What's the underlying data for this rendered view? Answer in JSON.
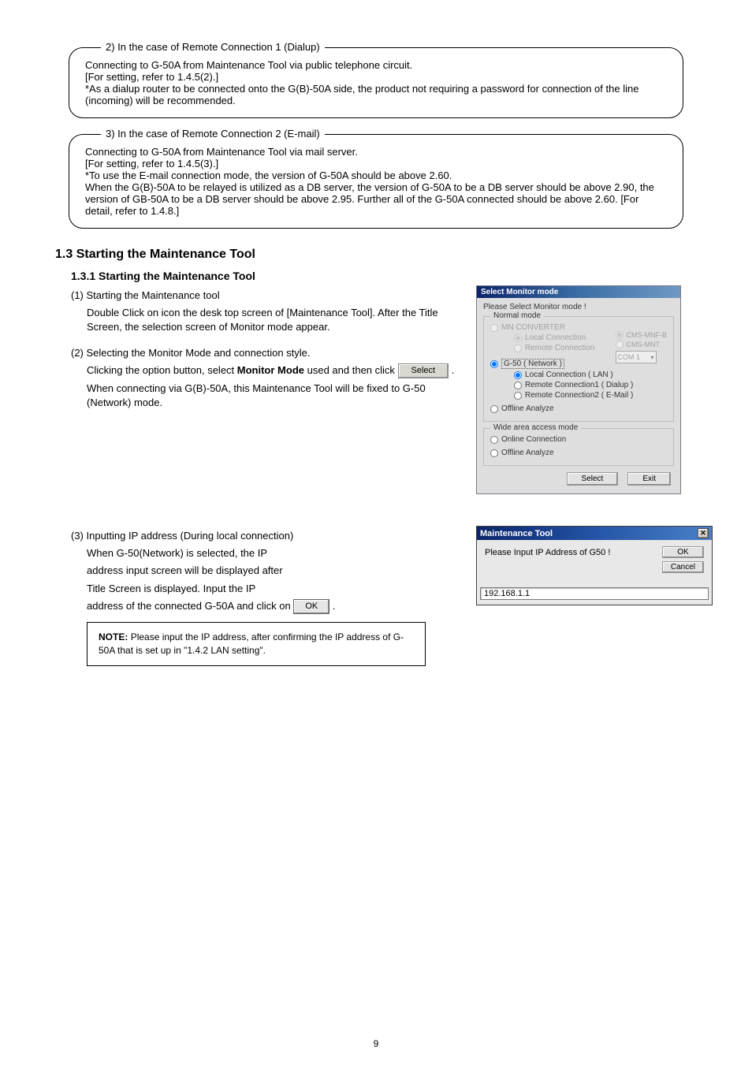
{
  "box_remote1": {
    "label": "2) In the case of Remote Connection 1 (Dialup)",
    "p1": "Connecting to G-50A from Maintenance Tool via public telephone circuit.",
    "p2": "[For setting, refer to 1.4.5(2).]",
    "p3": "*As a dialup router to be connected onto the G(B)-50A side, the product not requiring a password for connection of the line (incoming) will be recommended."
  },
  "box_remote2": {
    "label": "3) In the case of Remote Connection 2 (E-mail)",
    "p1": "Connecting to G-50A from Maintenance Tool via mail server.",
    "p2": "[For setting, refer to 1.4.5(3).]",
    "p3a": "*To use the E-mail connection mode, the version of G-50A should be above 2.60.",
    "p3b": " When the G(B)-50A to be relayed is utilized as a DB server, the version of G-50A to be a DB server should be above 2.90, the version of GB-50A to be a DB server should be above 2.95. Further all of the G-50A connected should be above 2.60. [For detail, refer to 1.4.8.]"
  },
  "h1_3": "1.3 Starting the Maintenance Tool",
  "h1_3_1": "1.3.1 Starting the Maintenance Tool",
  "step1": "(1) Starting the Maintenance tool",
  "step1_text": "Double Click on icon                     the desk top screen of [Maintenance Tool]. After the Title Screen, the selection screen of Monitor mode appear.",
  "step2": "(2) Selecting the Monitor Mode and connection style.",
  "step2_text_a": "Clicking the option button, select ",
  "step2_text_b": "Monitor Mode",
  "step2_text_c": " used and then click ",
  "step2_text_d": ".",
  "step2_text_e": "When connecting via G(B)-50A, this Maintenance Tool will be fixed to G-50 (Network) mode.",
  "step3": "(3) Inputting IP address (During local connection)",
  "step3_text_a": "When G-50(Network) is selected, the IP",
  "step3_text_b": "address input screen will be displayed after",
  "step3_text_c": "Title Screen is displayed. Input the IP",
  "step3_text_d": "address of the connected G-50A and click on",
  "step3_text_e": ".",
  "note": {
    "label": "NOTE:",
    "text": "Please input the IP address, after confirming the IP address of G-50A that is set up in \"1.4.2 LAN setting\"."
  },
  "dlg1": {
    "title": "Select Monitor mode",
    "prompt": "Please Select Monitor mode !",
    "fs_normal": "Normal mode",
    "mn": "MN CONVERTER",
    "mn_local": "Local Connection",
    "mn_remote": "Remote Connection",
    "cms_mnt_b": "CMS-MNF-B",
    "cms_mnt": "CMS-MNT",
    "com": "COM 1",
    "g50": "G-50 ( Network )",
    "g50_local": "Local Connection    ( LAN )",
    "g50_r1": "Remote Connection1 ( Dialup )",
    "g50_r2": "Remote Connection2 ( E-Mail )",
    "offline": "Offline Analyze",
    "fs_wide": "Wide area access mode",
    "online": "Online Connection",
    "offline2": "Offline Analyze",
    "select": "Select",
    "exit": "Exit"
  },
  "dlg2": {
    "title": "Maintenance Tool",
    "prompt": "Please Input IP Address of G50 !",
    "ok": "OK",
    "cancel": "Cancel",
    "ip": "192.168.1.1"
  },
  "btn_select": "Select",
  "btn_ok": "OK",
  "page_no": "9"
}
